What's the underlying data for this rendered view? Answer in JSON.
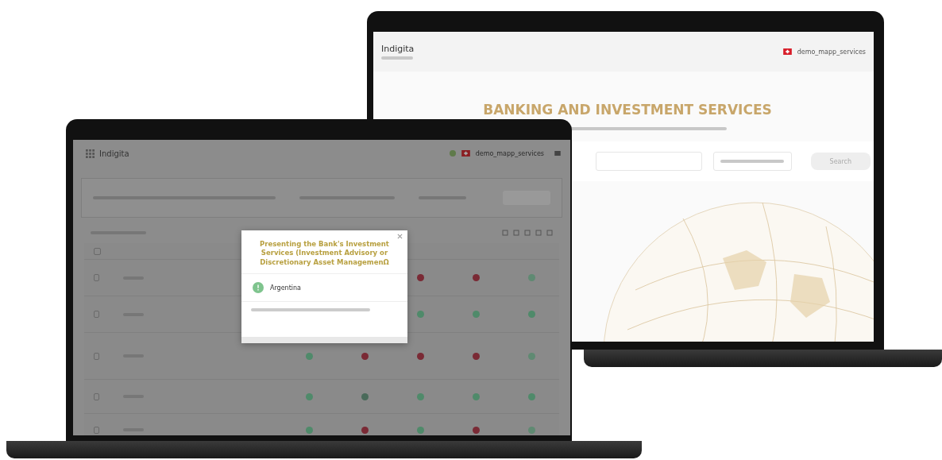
{
  "back_screen": {
    "logo": "Indigita",
    "username": "demo_mapp_services",
    "title": "BANKING AND INVESTMENT SERVICES",
    "search_button": "Search"
  },
  "front_screen": {
    "logo": "Indigita",
    "username": "demo_mapp_services",
    "header_checked": false,
    "rows": [
      {
        "checked": false,
        "dots": [
          {
            "color": "#7a2a35"
          },
          {
            "color": "#7a2a35"
          },
          {
            "color": "#5f8a72"
          }
        ]
      },
      {
        "checked": false,
        "dots": [
          {
            "color": "#4f8a6a"
          },
          {
            "color": "#4f8a6a"
          },
          {
            "color": "#4f8a6a"
          }
        ]
      },
      {
        "checked": false,
        "dots": [
          {
            "color": "#4f8a6a"
          },
          {
            "color": "#7a2a35"
          },
          {
            "color": "#7a2a35"
          },
          {
            "color": "#7a2a35"
          },
          {
            "color": "#5f8a72"
          }
        ]
      },
      {
        "checked": false,
        "dots": [
          {
            "color": "#4f8a6a"
          },
          {
            "color": "#4a6a5a"
          },
          {
            "color": "#4f8a6a"
          },
          {
            "color": "#4f8a6a"
          },
          {
            "color": "#4f8a6a"
          }
        ]
      },
      {
        "checked": false,
        "dots": [
          {
            "color": "#4f8a6a"
          },
          {
            "color": "#7a2a35"
          },
          {
            "color": "#4f8a6a"
          },
          {
            "color": "#7a2a35"
          },
          {
            "color": "#5f8a72"
          }
        ]
      }
    ]
  },
  "modal": {
    "title": "Presenting the Bank's Investment Services (Investment Advisory or Discretionary Asset ManagemenΩ",
    "country": "Argentina"
  }
}
